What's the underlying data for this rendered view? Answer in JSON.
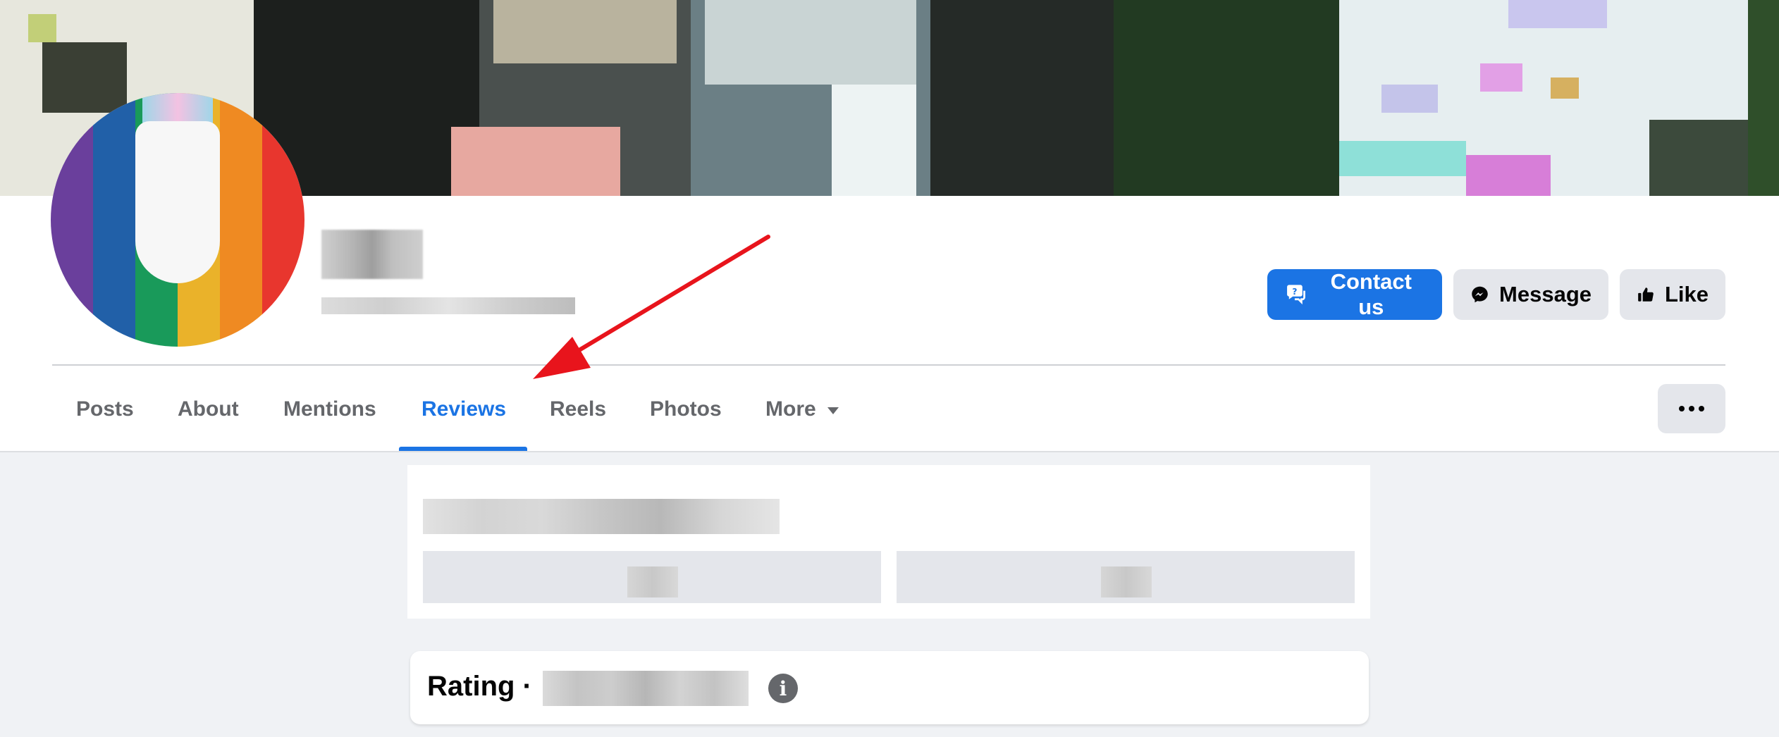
{
  "header": {
    "buttons": {
      "contact": "Contact us",
      "message": "Message",
      "like": "Like"
    }
  },
  "tabs": {
    "items": [
      "Posts",
      "About",
      "Mentions",
      "Reviews",
      "Reels",
      "Photos",
      "More"
    ],
    "active": "Reviews"
  },
  "rating": {
    "title": "Rating ·",
    "info_icon_glyph": "i"
  },
  "colors": {
    "accent": "#1b74e4",
    "arrow": "#e8141c"
  },
  "icons": {
    "contact": "chat-question-icon",
    "message": "messenger-icon",
    "like": "thumbs-up-icon",
    "more_caret": "caret-down-icon",
    "overflow": "more-dots-icon",
    "info": "info-icon"
  }
}
